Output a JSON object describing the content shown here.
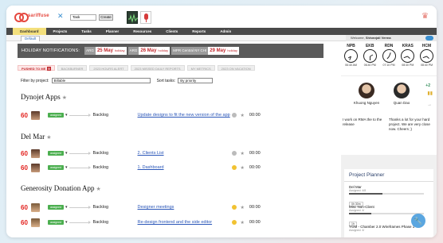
{
  "header": {
    "logo_text": "sariffuse",
    "task_select": "Task",
    "create_label": "Create"
  },
  "nav": {
    "items": [
      "Dashboard",
      "Projects",
      "Tasks",
      "Planner",
      "Resources",
      "Clients",
      "Reports",
      "Admin"
    ],
    "active_index": 0,
    "subtab": "Default",
    "welcome_prefix": "Welcome,",
    "welcome_user": "Shivanjali Verma"
  },
  "holidays": {
    "label": "HOLIDAY NOTIFICATIONS:",
    "items": [
      {
        "code": "ARG",
        "date": "25 May",
        "name": "holiday"
      },
      {
        "code": "ARG",
        "date": "26 May",
        "name": "holiday"
      },
      {
        "code": "MPR Central NY CHI",
        "date": "29 May",
        "name": "holiday"
      }
    ]
  },
  "tabs": {
    "pushed": "PUSHED TO ME",
    "pushed_count": "5",
    "others": [
      "BACKBURNER",
      "2023 HOURS ALERT",
      "2023 MISSED DAILY REPORTS",
      "MY METRICS",
      "2023 ON VACATION"
    ]
  },
  "filters": {
    "project_label": "Filter by project:",
    "project_value": "Billable",
    "sort_label": "Sort tasks:",
    "sort_value": "By priority"
  },
  "projects": [
    {
      "name": "Dynojet Apps",
      "tasks": [
        {
          "priority": "60",
          "status": "assigned",
          "stage": "Backlog",
          "title": "Update designs to fit the new version of the app",
          "time": "00:00",
          "mood": "gray"
        }
      ]
    },
    {
      "name": "Del Mar",
      "tasks": [
        {
          "priority": "60",
          "status": "assigned",
          "stage": "Backlog",
          "title": "2. Clients List",
          "time": "00:00",
          "mood": "gray"
        },
        {
          "priority": "60",
          "status": "assigned",
          "stage": "Backlog",
          "title": "1. Dashboard",
          "time": "00:00",
          "mood": "yellow"
        }
      ]
    },
    {
      "name": "Generosity Donation App",
      "tasks": [
        {
          "priority": "60",
          "status": "assigned",
          "stage": "Backlog",
          "title": "Designer meetings",
          "time": "00:00",
          "mood": "yellow"
        },
        {
          "priority": "60",
          "status": "assigned",
          "stage": "Backlog",
          "title": "Re-design frontend and the side editor",
          "time": "00:00",
          "mood": "yellow"
        }
      ]
    }
  ],
  "clocks": [
    {
      "code": "NPB",
      "time": "06:40 AM"
    },
    {
      "code": "EKB",
      "time": "06:40 PM"
    },
    {
      "code": "RDN",
      "time": "07:10 PM"
    },
    {
      "code": "KRAS",
      "time": "08:40 PM"
    },
    {
      "code": "HCM",
      "time": "08:40 PM"
    }
  ],
  "people": {
    "left_name": "Khuong Nguyen",
    "right_name": "Quan Dao",
    "left_msg": "I work on RMA the to the release",
    "right_msg": "Thanks a lot for your hard project. We are very close now. Cheers ;)",
    "plus_count": "+2"
  },
  "planner": {
    "title": "Project Planner",
    "items": [
      {
        "name": "Del Mar",
        "sub": "Assigned: 4/8",
        "time": "0h 30m",
        "progress": 0.45
      },
      {
        "name": "Misc Non-Client",
        "sub": "Assigned: 4/",
        "time": "1h",
        "progress": 0.3
      },
      {
        "name": "YGM - Chamber 2.0 Wireframes Phase 1",
        "sub": "Assigned: 4/",
        "time": "",
        "progress": 0.2
      }
    ]
  },
  "colors": {
    "accent": "#3a8fd0",
    "priority": "#e2201c",
    "status": "#4caf50",
    "holiday_bar": "#5a5a5a",
    "nav_active": "#f3df7c"
  }
}
